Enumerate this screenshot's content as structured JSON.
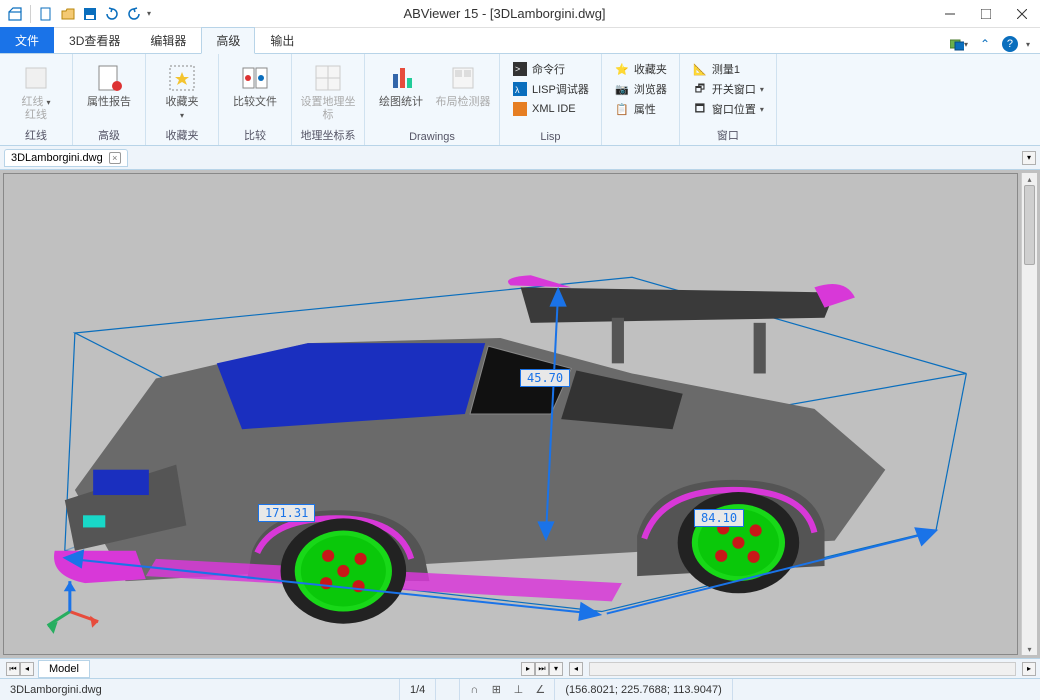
{
  "title": "ABViewer 15 - [3DLamborgini.dwg]",
  "tabs": {
    "file": "文件",
    "viewer3d": "3D查看器",
    "editor": "编辑器",
    "advanced": "高级",
    "output": "输出"
  },
  "ribbon": {
    "g1": {
      "btn": "红线",
      "sub": "红线",
      "label": "红线"
    },
    "g2": {
      "btn": "属性报告",
      "label": "高级"
    },
    "g3": {
      "btn": "收藏夹",
      "label": "收藏夹"
    },
    "g4": {
      "btn": "比较文件",
      "label": "比较"
    },
    "g5": {
      "btn": "设置地理坐标",
      "label": "地理坐标系"
    },
    "g6": {
      "btn": "绘图统计",
      "label": "Drawings"
    },
    "g7": {
      "btn": "布局检测器"
    },
    "g8": {
      "cmd": "命令行",
      "lisp": "LISP调试器",
      "xml": "XML IDE",
      "label": "Lisp"
    },
    "g9": {
      "fav": "收藏夹",
      "browser": "浏览器",
      "prop": "属性"
    },
    "g10": {
      "m1": "测量1",
      "sw": "开关窗口",
      "pos": "窗口位置",
      "label": "窗口"
    }
  },
  "doc": {
    "name": "3DLamborgini.dwg"
  },
  "dims": {
    "length": "171.31",
    "height": "45.70",
    "width": "84.10"
  },
  "bottom": {
    "model": "Model"
  },
  "status": {
    "file": "3DLamborgini.dwg",
    "page": "1/4",
    "coords": "(156.8021; 225.7688; 113.9047)"
  }
}
